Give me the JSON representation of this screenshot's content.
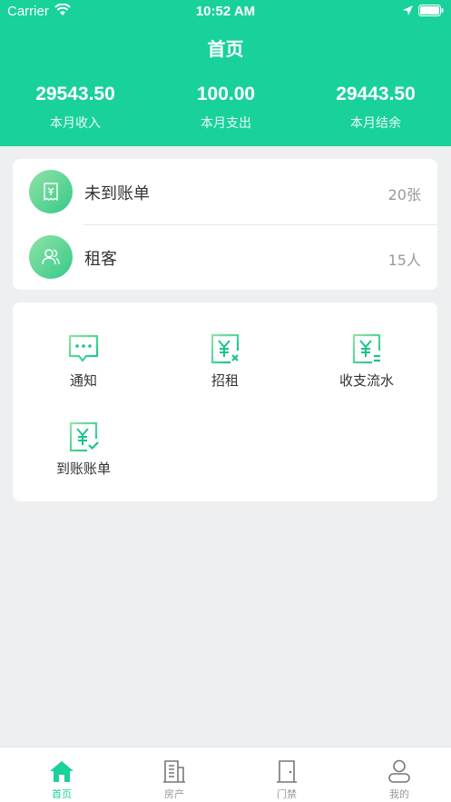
{
  "status_bar": {
    "carrier": "Carrier",
    "time": "10:52 AM"
  },
  "header": {
    "title": "首页",
    "stats": [
      {
        "value": "29543.50",
        "label": "本月收入"
      },
      {
        "value": "100.00",
        "label": "本月支出"
      },
      {
        "value": "29443.50",
        "label": "本月结余"
      }
    ]
  },
  "summary_list": [
    {
      "label": "未到账单",
      "count": "20张",
      "icon": "receipt-icon"
    },
    {
      "label": "租客",
      "count": "15人",
      "icon": "users-icon"
    }
  ],
  "actions": [
    {
      "label": "通知",
      "icon": "message-icon"
    },
    {
      "label": "招租",
      "icon": "yuan-cancel-icon"
    },
    {
      "label": "收支流水",
      "icon": "yuan-flow-icon"
    },
    {
      "label": "到账账单",
      "icon": "yuan-check-icon"
    }
  ],
  "tabbar": {
    "items": [
      {
        "label": "首页",
        "icon": "home-icon"
      },
      {
        "label": "房产",
        "icon": "building-icon"
      },
      {
        "label": "门禁",
        "icon": "door-icon"
      },
      {
        "label": "我的",
        "icon": "profile-icon"
      }
    ],
    "active_color": "#19d19b",
    "inactive_color": "#999999"
  },
  "colors": {
    "brand": "#19d19b",
    "background": "#eeeff0"
  }
}
